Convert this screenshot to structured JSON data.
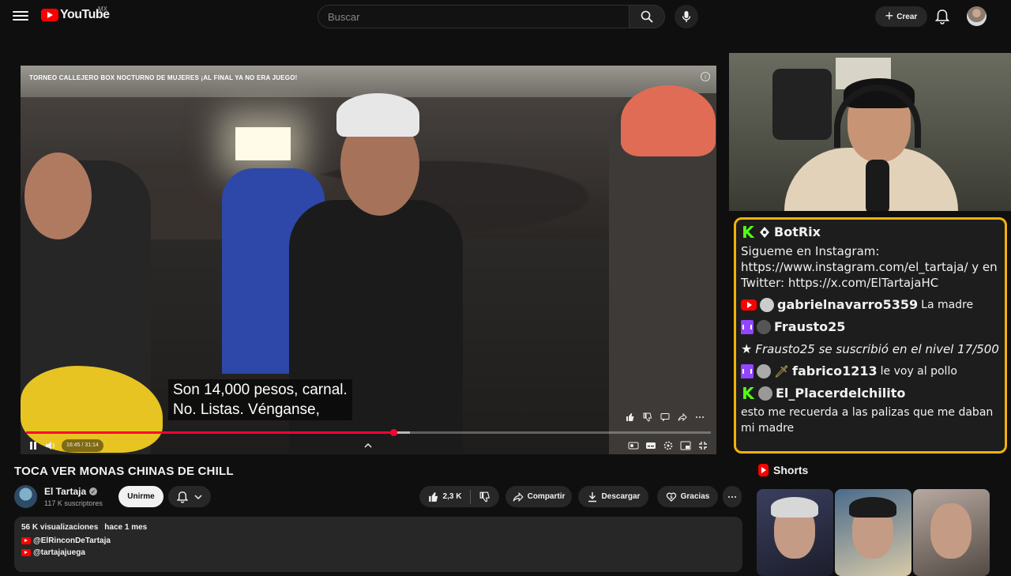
{
  "header": {
    "logo_text": "YouTube",
    "country": "MX",
    "search_placeholder": "Buscar",
    "create_label": "Crear"
  },
  "video": {
    "overlay_title": "TORNEO CALLEJERO BOX NOCTURNO DE MUJERES ¡AL FINAL YA NO ERA JUEGO!",
    "caption_line1": "Son 14,000 pesos, carnal.",
    "caption_line2": "No. Listas. Vénganse,",
    "time_display": "16:45 / 31:14",
    "progress_fraction": 0.537,
    "buffer_fraction": 0.56
  },
  "chat": {
    "messages": [
      {
        "platform": "kick",
        "user": "BotRix",
        "text": "Sigueme en Instagram: https://www.instagram.com/el_tartaja/ y en Twitter: https://x.com/ElTartajaHC"
      },
      {
        "platform": "youtube",
        "user": "gabrielnavarro5359",
        "text": "La madre"
      },
      {
        "platform": "twitch",
        "user": "Frausto25",
        "text": ""
      },
      {
        "platform": "system",
        "user": "",
        "text": "Frausto25 se suscribió en el nivel 17/500"
      },
      {
        "platform": "twitch",
        "user": "fabrico1213",
        "text": "le voy al pollo"
      },
      {
        "platform": "kick",
        "user": "El_Placerdelchilito",
        "text": "esto me recuerda a las palizas que me daban mi madre"
      }
    ]
  },
  "details": {
    "title": "TOCA VER MONAS CHINAS DE CHILL",
    "channel_name": "El Tartaja",
    "subscribers": "117 K suscriptores",
    "join_label": "Unirme",
    "likes": "2,3 K",
    "share_label": "Compartir",
    "download_label": "Descargar",
    "thanks_label": "Gracias",
    "views": "56 K visualizaciones",
    "age": "hace 1 mes",
    "link1": "@ElRinconDeTartaja",
    "link2": "@tartajajuega"
  },
  "shorts": {
    "heading": "Shorts"
  },
  "colors": {
    "accent_red": "#ff0033",
    "chat_border": "#f2b10c",
    "kick_green": "#53fc18",
    "twitch_purple": "#9146ff"
  }
}
